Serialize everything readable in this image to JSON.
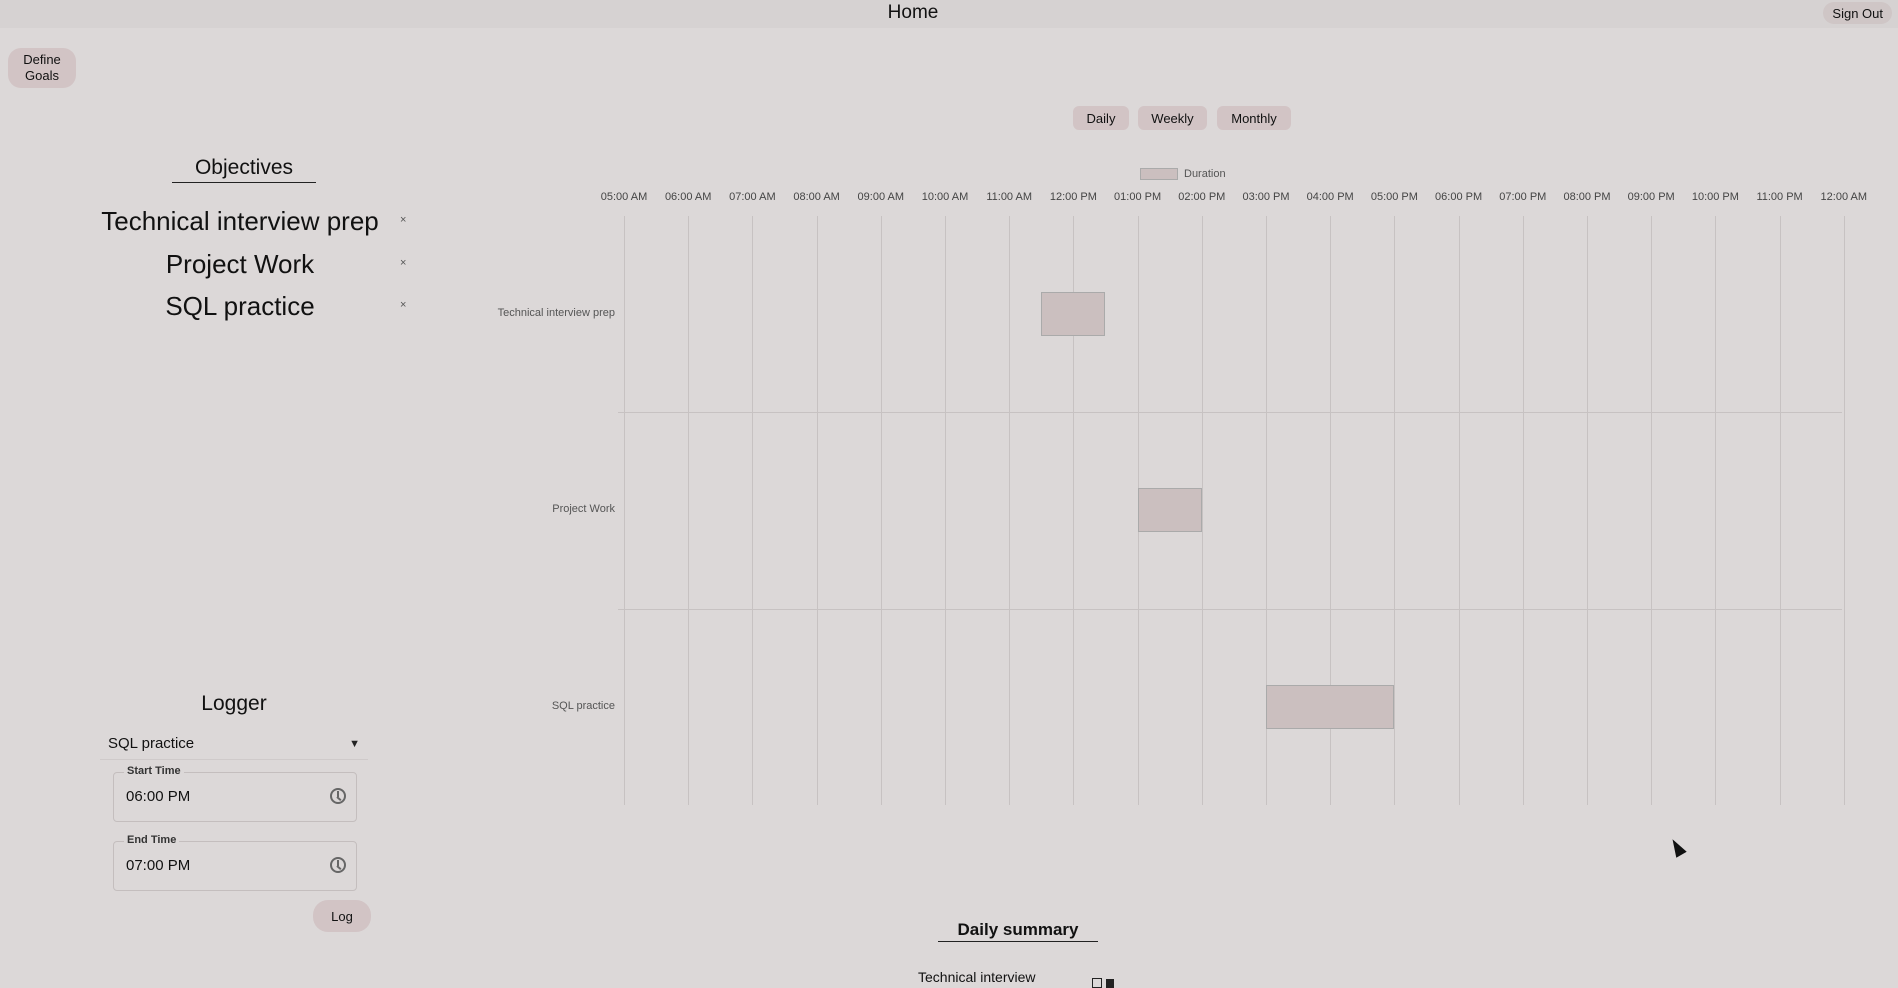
{
  "header": {
    "title": "Home",
    "sign_out_label": "Sign Out"
  },
  "define_goals_label": "Define\nGoals",
  "view_ranges": [
    "Daily",
    "Weekly",
    "Monthly"
  ],
  "objectives": {
    "title": "Objectives",
    "items": [
      "Technical interview prep",
      "Project Work",
      "SQL practice"
    ],
    "delete_glyph": "×"
  },
  "logger": {
    "title": "Logger",
    "selected_goal": "SQL practice",
    "start_time_label": "Start Time",
    "start_time_value": "06:00 PM",
    "end_time_label": "End Time",
    "end_time_value": "07:00 PM",
    "log_button_label": "Log",
    "colors": {
      "button": "#d2c4c5"
    }
  },
  "chart_data": {
    "type": "bar",
    "orientation": "horizontal-timeline",
    "legend": [
      {
        "name": "Duration",
        "color": "#cbbfbf"
      }
    ],
    "legend_position": "top",
    "x_ticks": [
      "05:00 AM",
      "06:00 AM",
      "07:00 AM",
      "08:00 AM",
      "09:00 AM",
      "10:00 AM",
      "11:00 AM",
      "12:00 PM",
      "01:00 PM",
      "02:00 PM",
      "03:00 PM",
      "04:00 PM",
      "05:00 PM",
      "06:00 PM",
      "07:00 PM",
      "08:00 PM",
      "09:00 PM",
      "10:00 PM",
      "11:00 PM",
      "12:00 AM"
    ],
    "xlim_hours": [
      5,
      24
    ],
    "categories": [
      "Technical interview prep",
      "Project Work",
      "SQL practice"
    ],
    "series": [
      {
        "name": "Duration",
        "values": [
          {
            "start_hour": 11.5,
            "end_hour": 12.5
          },
          {
            "start_hour": 13,
            "end_hour": 14
          },
          {
            "start_hour": 15,
            "end_hour": 17
          }
        ]
      }
    ],
    "grid": true
  },
  "summary": {
    "title": "Daily summary",
    "items": [
      "Technical interview"
    ]
  }
}
